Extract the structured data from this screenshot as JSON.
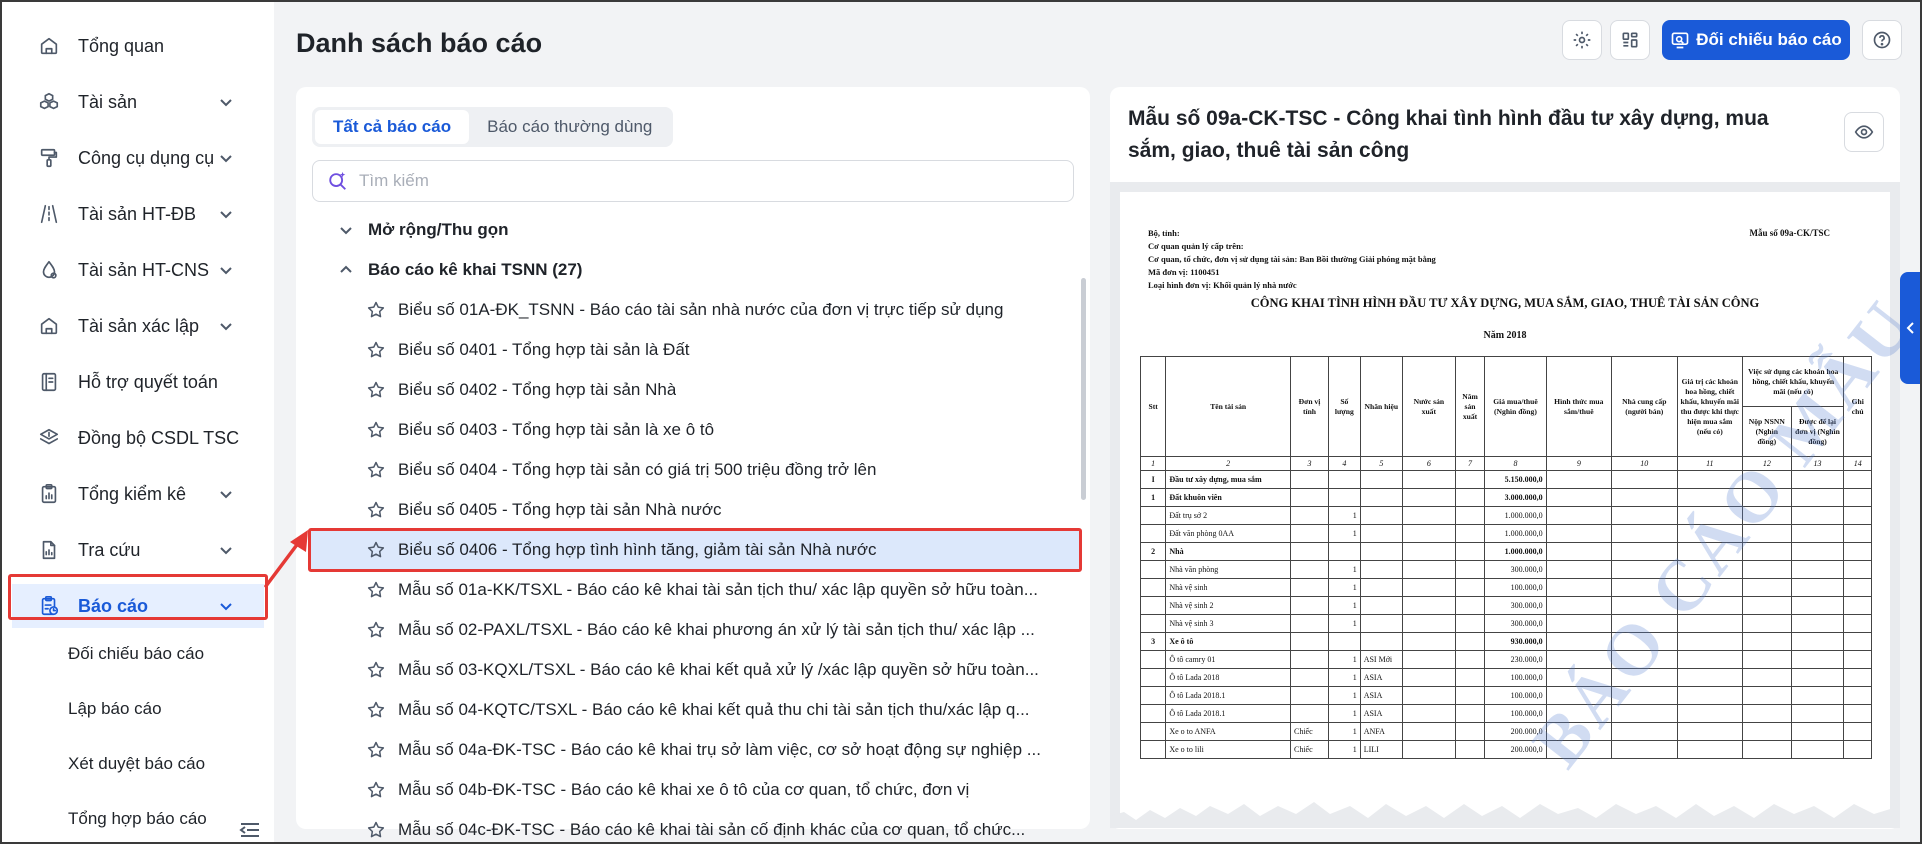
{
  "sidebar": {
    "items": [
      {
        "label": "Tổng quan",
        "icon": "home-icon",
        "expandable": false
      },
      {
        "label": "Tài sản",
        "icon": "cubes-icon",
        "expandable": true
      },
      {
        "label": "Công cụ dụng cụ",
        "icon": "paint-roller-icon",
        "expandable": true
      },
      {
        "label": "Tài sản HT-ĐB",
        "icon": "road-icon",
        "expandable": true
      },
      {
        "label": "Tài sản HT-CNS",
        "icon": "water-drop-icon",
        "expandable": true
      },
      {
        "label": "Tài sản xác lập",
        "icon": "home-icon",
        "expandable": true
      },
      {
        "label": "Hỗ trợ quyết toán",
        "icon": "notebook-icon",
        "expandable": false
      },
      {
        "label": "Đồng bộ CSDL TSC",
        "icon": "layers-icon",
        "expandable": false
      },
      {
        "label": "Tổng kiểm kê",
        "icon": "clipboard-chart-icon",
        "expandable": true
      },
      {
        "label": "Tra cứu",
        "icon": "file-chart-icon",
        "expandable": true
      },
      {
        "label": "Báo cáo",
        "icon": "report-icon",
        "expandable": true,
        "active": true
      }
    ],
    "sub_items": [
      "Đối chiếu báo cáo",
      "Lập báo cáo",
      "Xét duyệt báo cáo",
      "Tổng hợp báo cáo"
    ]
  },
  "header": {
    "title": "Danh sách báo cáo",
    "compare_button": "Đối chiếu báo cáo"
  },
  "list": {
    "tabs": [
      "Tất cả báo cáo",
      "Báo cáo thường dùng"
    ],
    "search_placeholder": "Tìm kiếm",
    "expand_collapse": "Mở rộng/Thu gọn",
    "group_label": "Báo cáo kê khai TSNN (27)",
    "items": [
      "Biểu số 01A-ĐK_TSNN - Báo cáo tài sản nhà nước của đơn vị trực tiếp sử dụng",
      "Biểu số 0401 - Tổng hợp tài sản là Đất",
      "Biểu số 0402 - Tổng hợp tài sản Nhà",
      "Biểu số 0403 - Tổng hợp tài sản là xe ô tô",
      "Biểu số 0404 - Tổng hợp tài sản có giá trị 500 triệu đồng trở lên",
      "Biểu số 0405 - Tổng hợp tài sản Nhà nước",
      "Biểu số 0406 - Tổng hợp tình hình tăng, giảm tài sản Nhà nước",
      "Mẫu số 01a-KK/TSXL - Báo cáo kê khai tài sản tịch thu/ xác lập quyền sở hữu toàn...",
      "Mẫu số 02-PAXL/TSXL - Báo cáo kê khai phương án xử lý tài sản tịch thu/ xác lập ...",
      "Mẫu số 03-KQXL/TSXL - Báo cáo kê khai kết quả xử lý /xác lập quyền sở hữu toàn...",
      "Mẫu số 04-KQTC/TSXL - Báo cáo kê khai kết quả thu chi tài sản tịch thu/xác lập q...",
      "Mẫu số 04a-ĐK-TSC - Báo cáo kê khai trụ sở làm việc, cơ sở hoạt động sự nghiệp ...",
      "Mẫu số 04b-ĐK-TSC - Báo cáo kê khai xe ô tô của cơ quan, tổ chức, đơn vị",
      "Mẫu số 04c-ĐK-TSC - Báo cáo kê khai tài sản cố định khác của cơ quan, tổ chức..."
    ],
    "selected_index": 6
  },
  "preview": {
    "title": "Mẫu số 09a-CK-TSC - Công khai tình hình đầu tư xây dựng, mua sắm, giao, thuê tài sản công",
    "doc": {
      "meta": [
        "Bộ, tỉnh:",
        "Cơ quan quản lý cấp trên:",
        "Cơ quan, tổ chức, đơn vị sử dụng tài sản: Ban Bồi thường Giải phóng mặt bằng",
        "Mã đơn vị: 1100451",
        "Loại hình đơn vị: Khối quản lý nhà nước"
      ],
      "form_no": "Mẫu số 09a-CK/TSC",
      "title": "CÔNG KHAI TÌNH HÌNH ĐẦU TƯ XÂY DỰNG, MUA SẮM, GIAO, THUÊ TÀI SẢN CÔNG",
      "year": "Năm 2018",
      "watermark": "BÁO CÁO MẪU",
      "columns": [
        "Stt",
        "Tên tài sản",
        "Đơn vị tính",
        "Số lượng",
        "Nhãn hiệu",
        "Nước sản xuất",
        "Năm sản xuất",
        "Giá mua/thuê (Nghìn đồng)",
        "Hình thức mua sắm/thuê",
        "Nhà cung cấp (người bán)",
        "Giá trị các khoản hoa hồng, chiết khấu, khuyến mãi thu được khi thực hiện mua sắm (nếu có)",
        "Nộp NSNN (Nghìn đồng)",
        "Được để lại đơn vị (Nghìn đồng)",
        "Ghi chú"
      ],
      "group_header": "Việc sử dụng các khoản hoa hồng, chiết khấu, khuyến mãi (nếu có)",
      "col_numbers": [
        "1",
        "2",
        "3",
        "4",
        "5",
        "6",
        "7",
        "8",
        "9",
        "10",
        "11",
        "12",
        "13",
        "14"
      ],
      "rows": [
        {
          "stt": "I",
          "name": "Đầu tư xây dựng, mua sắm",
          "unit": "",
          "qty": "",
          "brand": "",
          "price": "5.150.000,0",
          "bold": true
        },
        {
          "stt": "1",
          "name": "Đất khuôn viên",
          "unit": "",
          "qty": "",
          "brand": "",
          "price": "3.000.000,0",
          "bold": true
        },
        {
          "stt": "",
          "name": "Đất trụ sở 2",
          "unit": "",
          "qty": "1",
          "brand": "",
          "price": "1.000.000,0",
          "bold": false
        },
        {
          "stt": "",
          "name": "Đất văn phòng 0AA",
          "unit": "",
          "qty": "1",
          "brand": "",
          "price": "1.000.000,0",
          "bold": false
        },
        {
          "stt": "2",
          "name": "Nhà",
          "unit": "",
          "qty": "",
          "brand": "",
          "price": "1.000.000,0",
          "bold": true
        },
        {
          "stt": "",
          "name": "Nhà văn phòng",
          "unit": "",
          "qty": "1",
          "brand": "",
          "price": "300.000,0",
          "bold": false
        },
        {
          "stt": "",
          "name": "Nhà vệ sinh",
          "unit": "",
          "qty": "1",
          "brand": "",
          "price": "100.000,0",
          "bold": false
        },
        {
          "stt": "",
          "name": "Nhà vệ sinh 2",
          "unit": "",
          "qty": "1",
          "brand": "",
          "price": "300.000,0",
          "bold": false
        },
        {
          "stt": "",
          "name": "Nhà vệ sinh 3",
          "unit": "",
          "qty": "1",
          "brand": "",
          "price": "300.000,0",
          "bold": false
        },
        {
          "stt": "3",
          "name": "Xe ô tô",
          "unit": "",
          "qty": "",
          "brand": "",
          "price": "930.000,0",
          "bold": true
        },
        {
          "stt": "",
          "name": "Ô tô camry 01",
          "unit": "",
          "qty": "1",
          "brand": "ASI Mới",
          "price": "230.000,0",
          "bold": false
        },
        {
          "stt": "",
          "name": "Ô tô Lada 2018",
          "unit": "",
          "qty": "1",
          "brand": "ASIA",
          "price": "100.000,0",
          "bold": false
        },
        {
          "stt": "",
          "name": "Ô tô Lada 2018.1",
          "unit": "",
          "qty": "1",
          "brand": "ASIA",
          "price": "100.000,0",
          "bold": false
        },
        {
          "stt": "",
          "name": "Ô tô Lada 2018.1",
          "unit": "",
          "qty": "1",
          "brand": "ASIA",
          "price": "100.000,0",
          "bold": false
        },
        {
          "stt": "",
          "name": "Xe o to ANFA",
          "unit": "Chiếc",
          "qty": "1",
          "brand": "ANFA",
          "price": "200.000,0",
          "bold": false
        },
        {
          "stt": "",
          "name": "Xe o to lili",
          "unit": "Chiếc",
          "qty": "1",
          "brand": "LILI",
          "price": "200.000,0",
          "bold": false
        }
      ]
    }
  },
  "colors": {
    "primary": "#1a5ad8",
    "highlight": "#e53935",
    "selected_row": "#dce8fb"
  }
}
